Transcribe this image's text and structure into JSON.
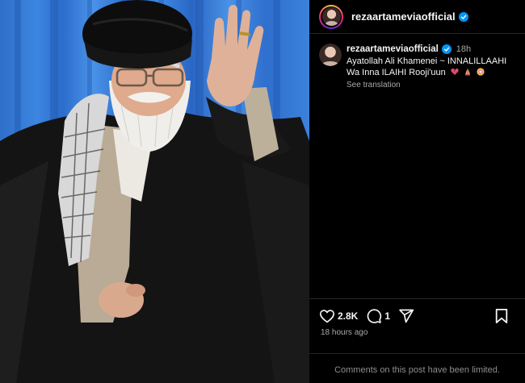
{
  "post": {
    "author": "rezaartameviaofficial",
    "verified": true,
    "caption_line1": "Ayatollah Ali Khamenei ~ INNALILLAAHI",
    "caption_line2": "Wa Inna ILAIHI Rooji'uun",
    "caption_emojis": [
      "broken-heart-icon",
      "praying-hands-icon",
      "face-emoji-icon"
    ],
    "posted_relative": "18h",
    "see_translation": "See translation",
    "likes": "2.8K",
    "comments": "1",
    "time_ago": "18 hours ago",
    "comments_limited": "Comments on this post have been limited."
  },
  "colors": {
    "background": "#000000",
    "verified": "#0095f6",
    "muted_text": "#a8a8a8",
    "divider": "#262626"
  }
}
